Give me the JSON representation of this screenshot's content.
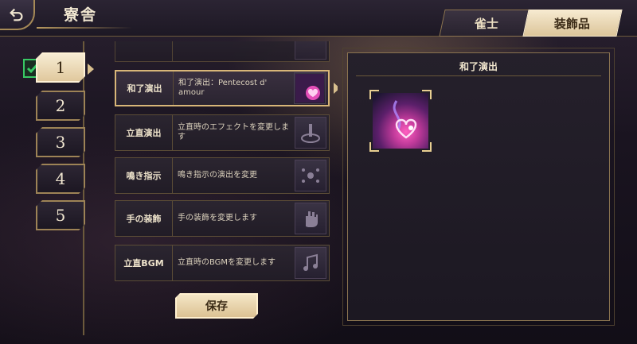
{
  "header": {
    "title": "寮舎",
    "tabs": [
      {
        "label": "雀士",
        "active": false
      },
      {
        "label": "装飾品",
        "active": true
      }
    ]
  },
  "slots": [
    {
      "label": "1",
      "active": true,
      "checked": true
    },
    {
      "label": "2",
      "active": false
    },
    {
      "label": "3",
      "active": false
    },
    {
      "label": "4",
      "active": false
    },
    {
      "label": "5",
      "active": false
    }
  ],
  "rows": [
    {
      "label": "和了演出",
      "desc": "和了演出：Pentecost d' amour",
      "selected": true,
      "icon": "heart-effect-icon"
    },
    {
      "label": "立直演出",
      "desc": "立直時のエフェクトを変更します",
      "selected": false,
      "icon": "riichi-effect-icon"
    },
    {
      "label": "鳴き指示",
      "desc": "鳴き指示の演出を変更",
      "selected": false,
      "icon": "call-indicator-icon"
    },
    {
      "label": "手の装飾",
      "desc": "手の装飾を変更します",
      "selected": false,
      "icon": "hand-icon"
    },
    {
      "label": "立直BGM",
      "desc": "立直時のBGMを変更します",
      "selected": false,
      "icon": "music-icon"
    }
  ],
  "save_label": "保存",
  "detail": {
    "title": "和了演出"
  },
  "colors": {
    "accent": "#d8b678",
    "active_tab": "#f6ead0",
    "check_green": "#38c864"
  }
}
